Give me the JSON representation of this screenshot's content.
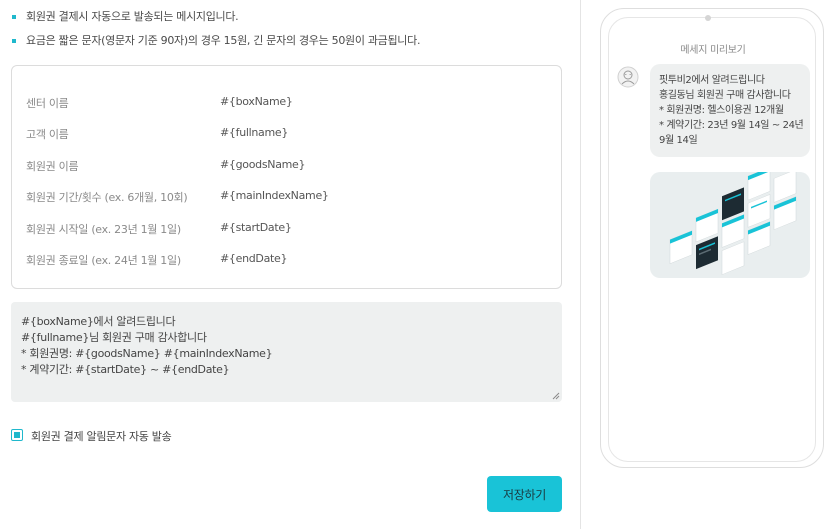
{
  "notes": [
    "회원권 결제시 자동으로 발송되는 메시지입니다.",
    "요금은 짧은 문자(영문자 기준 90자)의 경우 15원, 긴 문자의 경우는 50원이 과금됩니다."
  ],
  "variables": [
    {
      "label": "센터 이름",
      "value": "#{boxName}"
    },
    {
      "label": "고객 이름",
      "value": "#{fullname}"
    },
    {
      "label": "회원권 이름",
      "value": "#{goodsName}"
    },
    {
      "label": "회원권 기간/횟수 (ex. 6개월, 10회)",
      "value": "#{mainIndexName}"
    },
    {
      "label": "회원권 시작일 (ex. 23년 1월 1일)",
      "value": "#{startDate}"
    },
    {
      "label": "회원권 종료일 (ex. 24년 1월 1일)",
      "value": "#{endDate}"
    }
  ],
  "message_template": [
    "#{boxName}에서 알려드립니다",
    "#{fullname}님 회원권 구매 감사합니다",
    "* 회원권명: #{goodsName} #{mainIndexName}",
    "* 계약기간: #{startDate} ~ #{endDate}"
  ],
  "auto_send": {
    "label": "회원권 결제 알림문자 자동 발송",
    "checked": true
  },
  "save_label": "저장하기",
  "preview": {
    "title": "메세지 미리보기",
    "lines": [
      "핏투비2에서 알려드립니다",
      "홍길동님 회원권 구매 감사합니다",
      "* 회원권명: 헬스이용권 12개월",
      "* 계약기간: 23년 9월 14일 ~ 24년",
      "9월 14일"
    ]
  },
  "colors": {
    "accent": "#19c3d7",
    "bubble": "#eef0f0"
  },
  "icons": {
    "avatar": "user-avatar-icon",
    "checkbox": "checkbox-checked-icon"
  }
}
